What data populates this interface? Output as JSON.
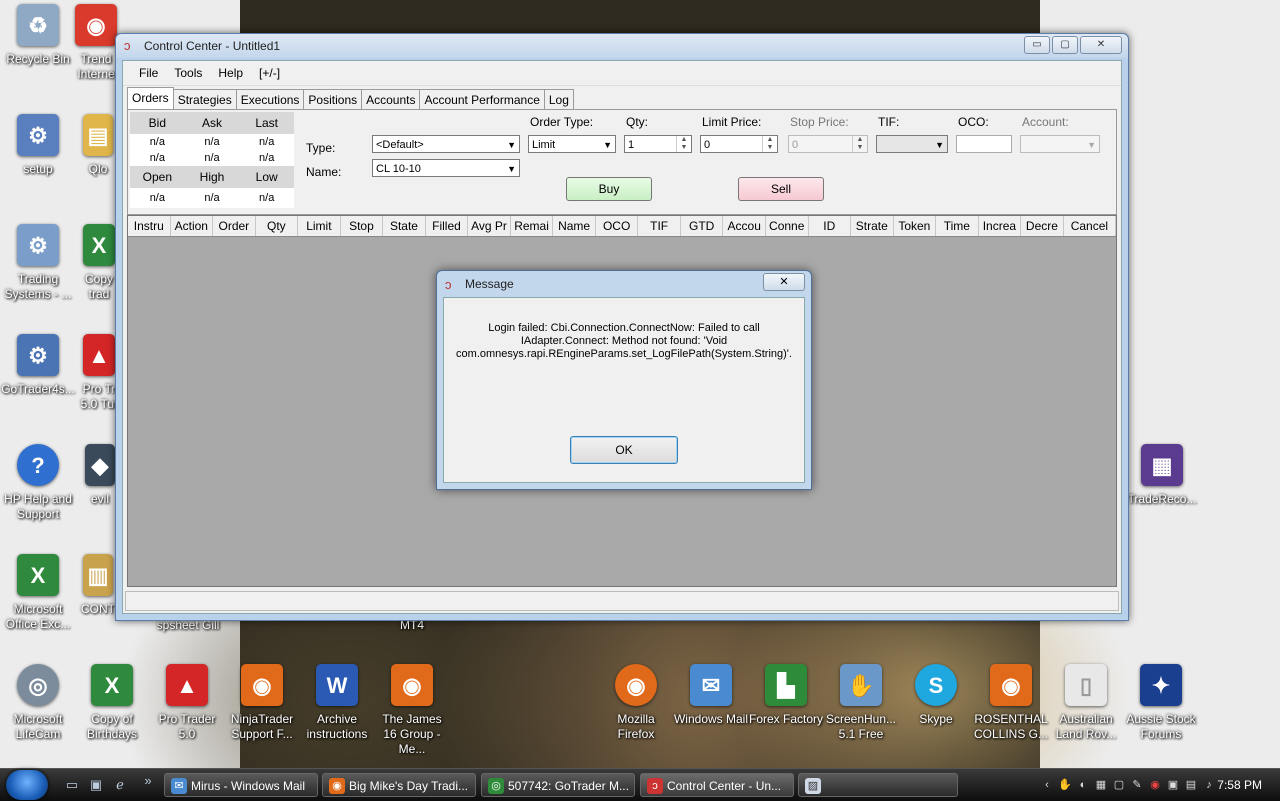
{
  "desktop": {
    "icons": [
      {
        "label": "Recycle Bin",
        "glyph": "♻",
        "color": "#8fa9c5"
      },
      {
        "label": "Trend Interne",
        "glyph": "◉",
        "color": "#d93a2b"
      },
      {
        "label": "setup",
        "glyph": "⚙",
        "color": "#5a7fbf"
      },
      {
        "label": "Qlo",
        "glyph": "▤",
        "color": "#e0b64a"
      },
      {
        "label": "Trading Systems - ...",
        "glyph": "⚙",
        "color": "#7a9ec9"
      },
      {
        "label": "Copy trad",
        "glyph": "X",
        "color": "#2f8a3e"
      },
      {
        "label": "GoTrader4s...",
        "glyph": "⚙",
        "color": "#4b74b5"
      },
      {
        "label": "Pro Tr 5.0 Tut",
        "glyph": "▲",
        "color": "#d42626"
      },
      {
        "label": "HP Help and Support",
        "glyph": "?",
        "color": "#2f6fd0"
      },
      {
        "label": "evil",
        "glyph": "◆",
        "color": "#3a4a5a"
      },
      {
        "label": "Microsoft Office Exc...",
        "glyph": "X",
        "color": "#2f8a3e"
      },
      {
        "label": "CONT",
        "glyph": "▥",
        "color": "#c9a24c"
      },
      {
        "label": "spsheet Gill",
        "glyph": "",
        "color": ""
      },
      {
        "label": "MT4",
        "glyph": "",
        "color": ""
      },
      {
        "label": "TradeReco...",
        "glyph": "▦",
        "color": "#5b3b8f"
      },
      {
        "label": "Microsoft LifeCam",
        "glyph": "◎",
        "color": "#7c8c9c"
      },
      {
        "label": "Copy of Birthdays",
        "glyph": "X",
        "color": "#2f8a3e"
      },
      {
        "label": "Pro Trader 5.0",
        "glyph": "▲",
        "color": "#d42626"
      },
      {
        "label": "NinjaTrader Support F...",
        "glyph": "◉",
        "color": "#e06a1a"
      },
      {
        "label": "Archive instructions",
        "glyph": "W",
        "color": "#2b5ab5"
      },
      {
        "label": "The James 16 Group - Me...",
        "glyph": "◉",
        "color": "#e06a1a"
      },
      {
        "label": "Mozilla Firefox",
        "glyph": "◉",
        "color": "#e06a1a"
      },
      {
        "label": "Windows Mail",
        "glyph": "✉",
        "color": "#4a8ad0"
      },
      {
        "label": "Forex Factory",
        "glyph": "▙",
        "color": "#2e8b3a"
      },
      {
        "label": "ScreenHun... 5.1 Free",
        "glyph": "✋",
        "color": "#6a98c8"
      },
      {
        "label": "Skype",
        "glyph": "S",
        "color": "#1fa8e0"
      },
      {
        "label": "ROSENTHAL COLLINS G...",
        "glyph": "◉",
        "color": "#e06a1a"
      },
      {
        "label": "Australian Land Rov...",
        "glyph": "▯",
        "color": "#e8e8e8"
      },
      {
        "label": "Aussie Stock Forums",
        "glyph": "✦",
        "color": "#1b3f8f"
      }
    ]
  },
  "window": {
    "title": "Control Center - Untitled1",
    "controls": {
      "minimize": "▭",
      "maximize": "▢",
      "close": "✕"
    },
    "menu": [
      "File",
      "Tools",
      "Help",
      "[+/-]"
    ],
    "tabs": [
      "Orders",
      "Strategies",
      "Executions",
      "Positions",
      "Accounts",
      "Account Performance",
      "Log"
    ],
    "quote": {
      "headers1": [
        "Bid",
        "Ask",
        "Last"
      ],
      "row1": [
        "n/a",
        "n/a",
        "n/a"
      ],
      "row2": [
        "n/a",
        "n/a",
        "n/a"
      ],
      "headers2": [
        "Open",
        "High",
        "Low"
      ],
      "row3": [
        "n/a",
        "n/a",
        "n/a"
      ]
    },
    "form": {
      "type_label": "Type:",
      "type_value": "<Default>",
      "name_label": "Name:",
      "name_value": "CL 10-10",
      "order_type_label": "Order Type:",
      "order_type_value": "Limit",
      "qty_label": "Qty:",
      "qty_value": "1",
      "limit_price_label": "Limit Price:",
      "limit_price_value": "0",
      "stop_price_label": "Stop Price:",
      "stop_price_value": "0",
      "tif_label": "TIF:",
      "tif_value": "",
      "oco_label": "OCO:",
      "oco_value": "",
      "account_label": "Account:",
      "account_value": "",
      "buy_label": "Buy",
      "sell_label": "Sell"
    },
    "grid_columns": [
      "Instru",
      "Action",
      "Order",
      "Qty",
      "Limit",
      "Stop",
      "State",
      "Filled",
      "Avg Pr",
      "Remai",
      "Name",
      "OCO",
      "TIF",
      "GTD",
      "Accou",
      "Conne",
      "ID",
      "Strate",
      "Token",
      "Time",
      "Increa",
      "Decre",
      "Cancel"
    ]
  },
  "dialog": {
    "title": "Message",
    "close": "✕",
    "line1": "Login failed: Cbi.Connection.ConnectNow: Failed to call",
    "line2": "IAdapter.Connect:  Method not found: 'Void",
    "line3": "com.omnesys.rapi.REngineParams.set_LogFilePath(System.String)'.",
    "ok_label": "OK"
  },
  "taskbar": {
    "items": [
      {
        "label": "Mirus - Windows Mail",
        "color": "#4a8ad0",
        "glyph": "✉"
      },
      {
        "label": "Big Mike's Day Tradi...",
        "color": "#e06a1a",
        "glyph": "◉"
      },
      {
        "label": "507742: GoTrader M...",
        "color": "#2e8b3a",
        "glyph": "◎"
      },
      {
        "label": "Control Center - Un...",
        "color": "#c33",
        "glyph": "ↄ"
      },
      {
        "label": "",
        "color": "#cfd9e6",
        "glyph": "▨"
      }
    ],
    "clock": "7:58 PM"
  }
}
